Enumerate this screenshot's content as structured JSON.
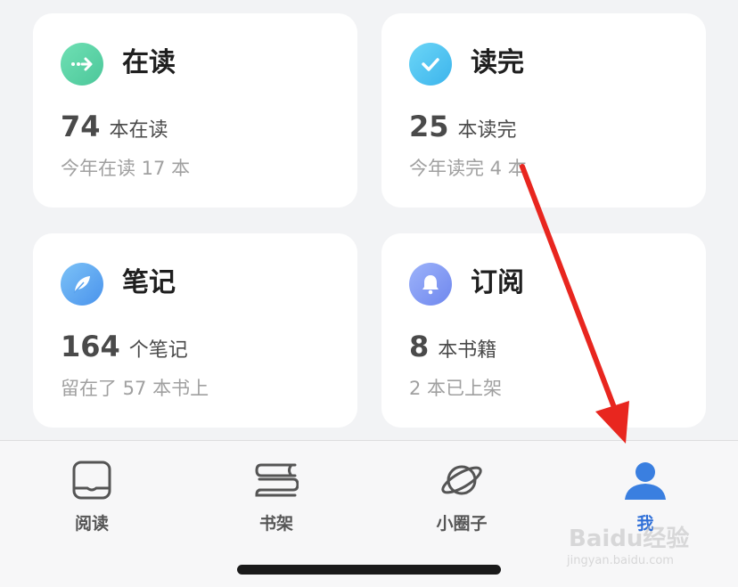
{
  "cards": [
    {
      "title": "在读",
      "number": "74",
      "unit": "本在读",
      "subtitle": "今年在读 17 本",
      "icon": "arrow-right-icon",
      "color": "#5fd3a6"
    },
    {
      "title": "读完",
      "number": "25",
      "unit": "本读完",
      "subtitle": "今年读完 4 本",
      "icon": "check-icon",
      "color": "#4fc3f0"
    },
    {
      "title": "笔记",
      "number": "164",
      "unit": "个笔记",
      "subtitle": "留在了 57 本书上",
      "icon": "feather-icon",
      "color": "#5aaaf0"
    },
    {
      "title": "订阅",
      "number": "8",
      "unit": "本书籍",
      "subtitle": "2 本已上架",
      "icon": "bell-icon",
      "color": "#7d9af5"
    }
  ],
  "tabbar": {
    "items": [
      {
        "label": "阅读",
        "icon": "book-icon"
      },
      {
        "label": "书架",
        "icon": "bookshelf-icon"
      },
      {
        "label": "小圈子",
        "icon": "planet-icon"
      },
      {
        "label": "我",
        "icon": "person-icon",
        "active": true
      }
    ],
    "active_color": "#2f6fd8"
  },
  "watermark": {
    "brand": "Baidu经验",
    "url": "jingyan.baidu.com"
  },
  "annotation_color": "#e8261f"
}
